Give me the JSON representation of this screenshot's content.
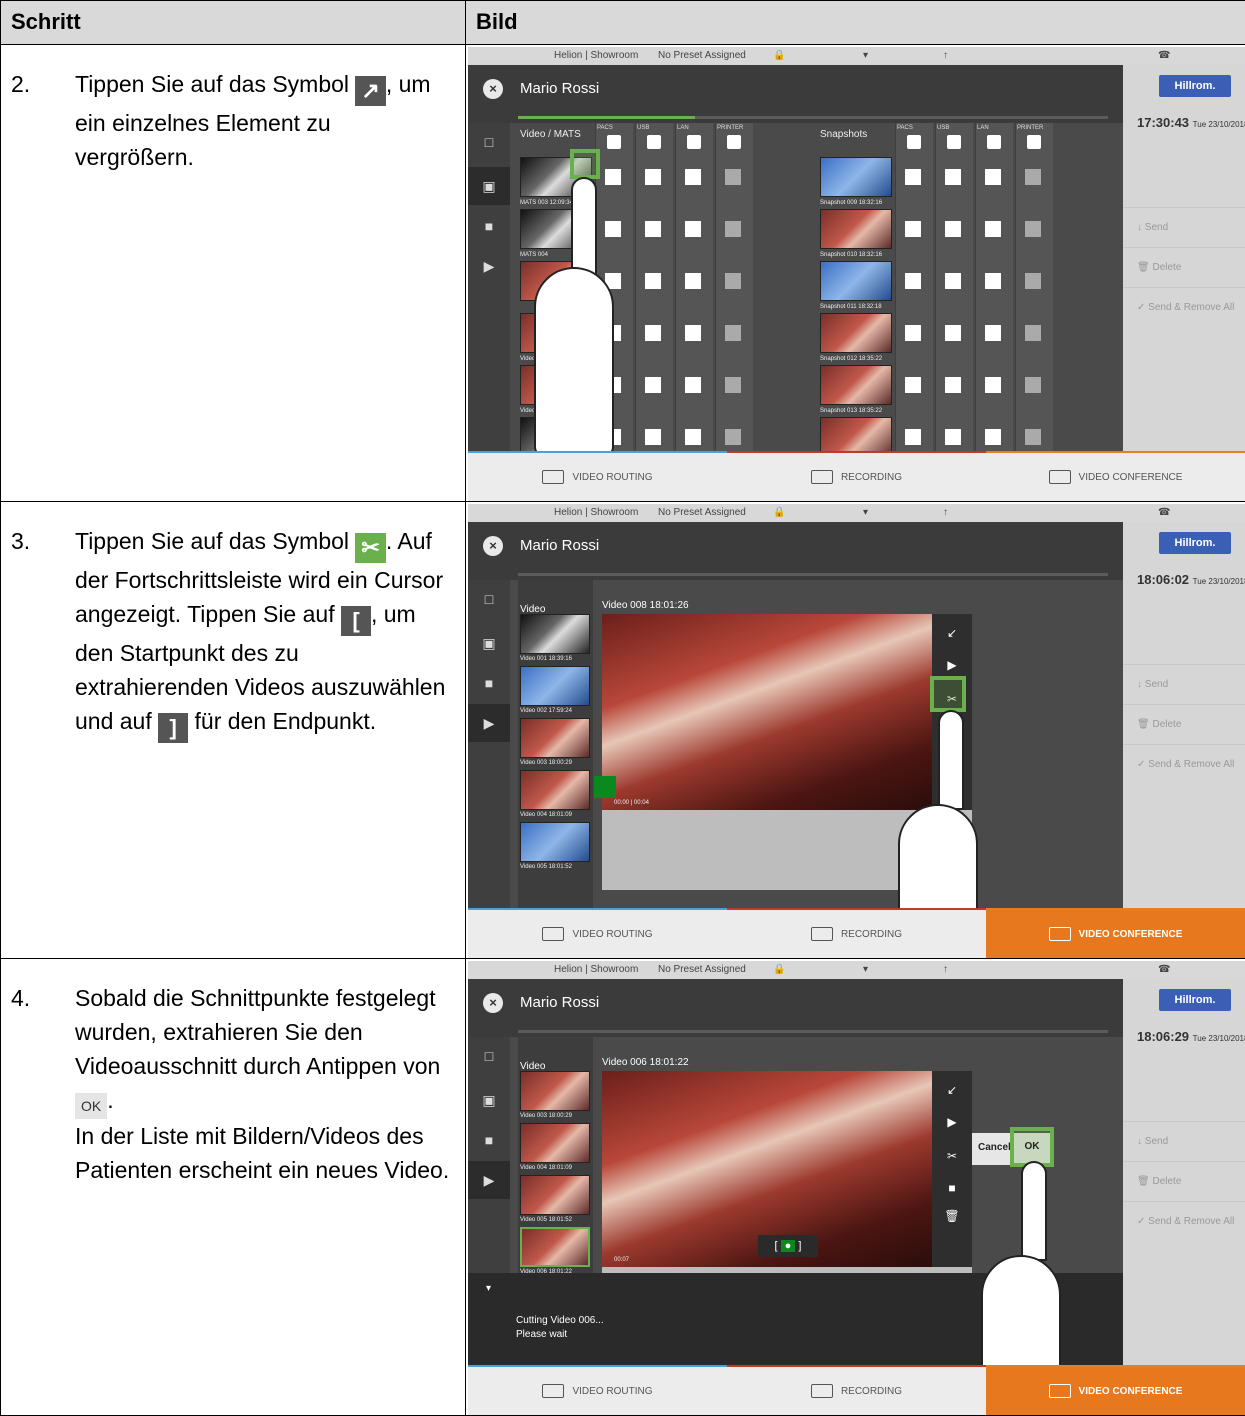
{
  "table": {
    "col_step": "Schritt",
    "col_image": "Bild"
  },
  "rows": [
    {
      "num": "2.",
      "text_a": "Tippen Sie auf das Symbol",
      "icon_a": "expand-icon",
      "text_b": ", um ein einzelnes Element zu vergrößern."
    },
    {
      "num": "3.",
      "text_a": "Tippen Sie auf das Symbol",
      "icon_a": "scissors-icon",
      "text_b": ". Auf der Fortschrittsleiste wird ein Cursor angezeigt. Tippen Sie auf",
      "icon_b_label": "[",
      "text_c": ", um den Startpunkt des zu extrahierenden Videos auszuwählen und auf",
      "icon_c_label": "]",
      "text_d": "für den Endpunkt."
    },
    {
      "num": "4.",
      "text_a": "Sobald die Schnittpunkte festgelegt wurden, extrahieren Sie den Videoausschnitt durch Antippen von",
      "icon_a_label": "OK",
      "text_b": ".",
      "text_c": "In der Liste mit Bildern/Videos des Patienten erscheint ein neues Video."
    }
  ],
  "screen": {
    "topbar": {
      "location": "Helion | Showroom",
      "preset": "No Preset Assigned"
    },
    "patient": "Mario Rossi",
    "logo": "Hillrom.",
    "actions": {
      "send": "Send",
      "delete": "Delete",
      "send_remove": "Send & Remove All"
    },
    "tabs": {
      "routing": "VIDEO ROUTING",
      "recording": "RECORDING",
      "conference": "VIDEO CONFERENCE"
    }
  },
  "screens": [
    {
      "clock": "17:30:43",
      "date": "Tue 23/10/2018",
      "left_title": "Video / MATS",
      "right_title": "Snapshots",
      "dest": [
        "PACS",
        "USB",
        "LAN",
        "PRINTER"
      ],
      "left_items": [
        "MATS 003 12:09:34",
        "MATS 004",
        "Video 00",
        "Video 005 18:23:32"
      ],
      "right_items": [
        "Snapshot 009 18:32:16",
        "Snapshot 010 18:32:16",
        "Snapshot 011 18:32:18",
        "Snapshot 012 18:35:22",
        "Snapshot 013 18:35:22"
      ]
    },
    {
      "clock": "18:06:02",
      "date": "Tue 23/10/2018",
      "list_title": "Video",
      "player_title": "Video 008 18:01:26",
      "items": [
        "Video 001 18:39:16",
        "Video 002 17:59:24",
        "Video 003 18:00:29",
        "Video 004 18:01:09",
        "Video 005 18:01:52"
      ],
      "time": "00:00 | 00:04"
    },
    {
      "clock": "18:06:29",
      "date": "Tue 23/10/2018",
      "list_title": "Video",
      "player_title": "Video 006 18:01:22",
      "items": [
        "Video 003 18:00:29",
        "Video 004 18:01:09",
        "Video 005 18:01:52",
        "Video 006 18:01:22"
      ],
      "cancel": "Cancel",
      "ok": "OK",
      "msg1": "Cutting Video 006...",
      "msg2": "Please wait",
      "time": "00:07"
    }
  ],
  "colors": {
    "green": "#6ab04c",
    "orange": "#e8781e",
    "dark": "#4a4a4a"
  }
}
